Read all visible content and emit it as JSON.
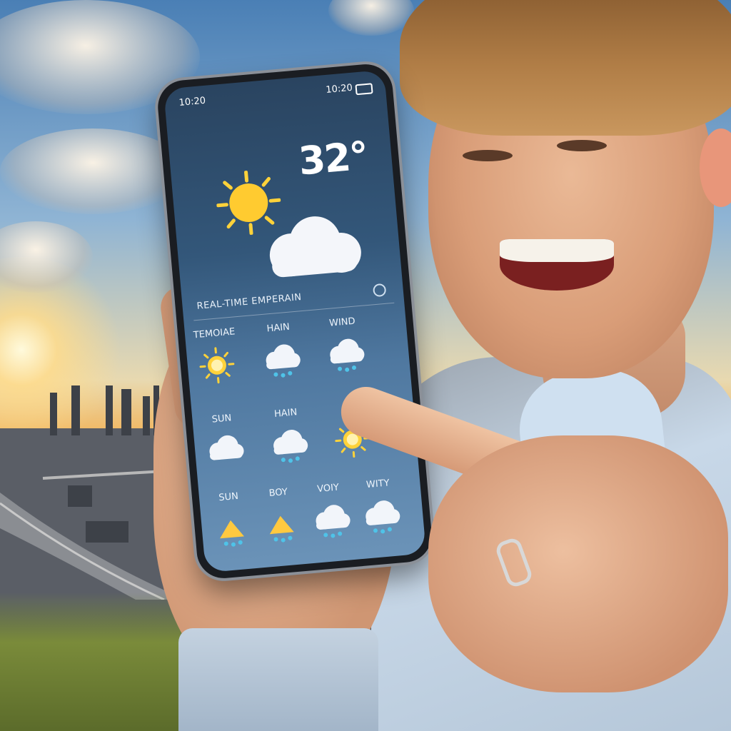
{
  "phone": {
    "status_time_left": "10:20",
    "status_time_right": "10:20",
    "temperature": "32°",
    "subtitle": "REAL-TIME EMPERAIN",
    "forecast_rows": [
      {
        "cells": [
          {
            "label": "TEMOIAE",
            "icon": "sun-icon"
          },
          {
            "label": "HAIN",
            "icon": "rain-cloud-icon"
          },
          {
            "label": "WIND",
            "icon": "rain-cloud-icon"
          }
        ]
      },
      {
        "cells": [
          {
            "label": "SUN",
            "icon": "cloud-icon"
          },
          {
            "label": "HAIN",
            "icon": "rain-cloud-icon"
          },
          {
            "label": "",
            "icon": "sun-icon"
          }
        ]
      },
      {
        "cells": [
          {
            "label": "SUN",
            "icon": "storm-cloud-icon"
          },
          {
            "label": "BOY",
            "icon": "storm-cloud-icon"
          },
          {
            "label": "VOIY",
            "icon": "rain-cloud-icon"
          },
          {
            "label": "WITY",
            "icon": "rain-cloud-icon"
          }
        ]
      }
    ]
  },
  "colors": {
    "sky": "#4a7fb5",
    "sunset": "#f2b45a",
    "screen": "#33577a",
    "sun": "#ffd23a"
  }
}
